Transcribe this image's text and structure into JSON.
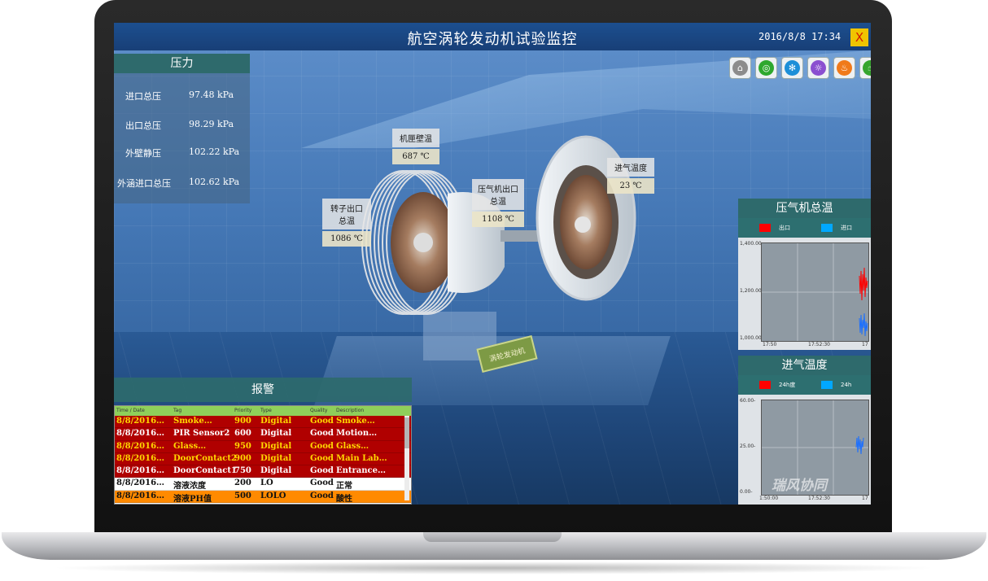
{
  "window": {
    "title": "航空涡轮发动机试验监控",
    "datetime": "2016/8/8  17:34",
    "close_label": "X"
  },
  "toolbar": {
    "icons": [
      "home-icon",
      "globe-icon",
      "fan-icon",
      "bulb-icon",
      "fire-icon",
      "hand-icon"
    ]
  },
  "pressure": {
    "title": "压力",
    "rows": [
      {
        "label": "进口总压",
        "value": "97.48 kPa"
      },
      {
        "label": "出口总压",
        "value": "98.29 kPa"
      },
      {
        "label": "外壁静压",
        "value": "102.22 kPa"
      },
      {
        "label": "外涵进口总压",
        "value": "102.62 kPa"
      }
    ]
  },
  "tags": [
    {
      "name": "机匣壁温",
      "value": "687 ℃"
    },
    {
      "name": "进气温度",
      "value": "23 ℃"
    },
    {
      "name": "压气机出口总温",
      "value": "1108 ℃"
    },
    {
      "name": "转子出口总温",
      "value": "1086 ℃"
    }
  ],
  "plate_text": "涡轮发动机",
  "chart_data": [
    {
      "type": "line",
      "title": "压气机总温",
      "series": [
        {
          "name": "出口",
          "color": "#ff0000"
        },
        {
          "name": "进口",
          "color": "#00a8ff"
        }
      ],
      "y_ticks": [
        "1,400.00-",
        "1,200.00-",
        "1,000.00-"
      ],
      "x_ticks": [
        "17:50",
        "17:52:30",
        "17"
      ],
      "ylim": [
        1000,
        1400
      ]
    },
    {
      "type": "line",
      "title": "进气温度",
      "series": [
        {
          "name": "24h度",
          "color": "#ff0000"
        },
        {
          "name": "24h",
          "color": "#00a8ff"
        }
      ],
      "y_ticks": [
        "60.00-",
        "25.00-",
        "0.00-"
      ],
      "x_ticks": [
        "1:50:00",
        "17:52:30",
        "17"
      ],
      "ylim": [
        0,
        60
      ]
    }
  ],
  "alarm": {
    "title": "报警",
    "headers": [
      "Time / Date",
      "Tag",
      "Priority",
      "Type",
      "Quality",
      "Description"
    ],
    "rows": [
      {
        "time": "8/8/2016…",
        "tag": "Smoke…",
        "priority": "900",
        "type": "Digital",
        "quality": "Good",
        "desc": "Smoke…",
        "bg": "#b00000",
        "fg": "#ffd800"
      },
      {
        "time": "8/8/2016…",
        "tag": "PIR Sensor2",
        "priority": "600",
        "type": "Digital",
        "quality": "Good",
        "desc": "Motion…",
        "bg": "#b00000",
        "fg": "#ffffff"
      },
      {
        "time": "8/8/2016…",
        "tag": "Glass…",
        "priority": "950",
        "type": "Digital",
        "quality": "Good",
        "desc": "Glass…",
        "bg": "#b00000",
        "fg": "#ffd800"
      },
      {
        "time": "8/8/2016…",
        "tag": "DoorContact2",
        "priority": "900",
        "type": "Digital",
        "quality": "Good",
        "desc": "Main Lab…",
        "bg": "#b00000",
        "fg": "#ffd800"
      },
      {
        "time": "8/8/2016…",
        "tag": "DoorContact1",
        "priority": "750",
        "type": "Digital",
        "quality": "Good",
        "desc": "Entrance…",
        "bg": "#b00000",
        "fg": "#ffffff"
      },
      {
        "time": "8/8/2016…",
        "tag": "溶液浓度",
        "priority": "200",
        "type": "LO",
        "quality": "Good",
        "desc": "正常",
        "bg": "#ffffff",
        "fg": "#111111"
      },
      {
        "time": "8/8/2016…",
        "tag": "溶液PH值",
        "priority": "500",
        "type": "LOLO",
        "quality": "Good",
        "desc": "酸性",
        "bg": "#ff8a00",
        "fg": "#111111"
      }
    ]
  },
  "watermark": "瑞风协同"
}
